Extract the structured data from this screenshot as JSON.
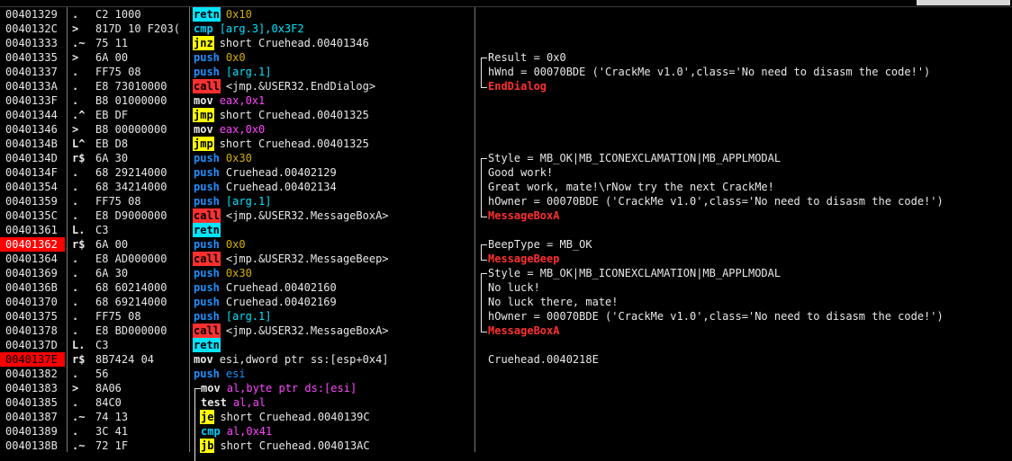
{
  "window": {
    "title": ""
  },
  "colors": {
    "background": "#000000",
    "breakpoint": "#ff0000",
    "ret": "#00e5ff",
    "jmp": "#ffff00",
    "call": "#ff3030",
    "push": "#1e90ff"
  },
  "rows": [
    {
      "addr": "00401329",
      "gutter": ".",
      "hex": "C2 1000",
      "mnem": "retn",
      "mclass": "m-ret",
      "ops": "0x10",
      "oclass": "op-gold",
      "comment": ""
    },
    {
      "addr": "0040132C",
      "gutter": ">",
      "hex": "817D 10 F203(",
      "mnem": "cmp",
      "mclass": "m-cmp",
      "ops": "[arg.3],0x3F2",
      "oclass": "op-cyan",
      "comment": ""
    },
    {
      "addr": "00401333",
      "gutter": ".~",
      "hex": "75 11",
      "mnem": "jnz",
      "mclass": "m-jmp",
      "ops": "short Cruehead.00401346",
      "oclass": "op-white",
      "comment": ""
    },
    {
      "addr": "00401335",
      "gutter": ">",
      "hex": "6A 00",
      "mnem": "push",
      "mclass": "m-push",
      "ops": "0x0",
      "oclass": "op-gold",
      "comment": "Result = 0x0"
    },
    {
      "addr": "00401337",
      "gutter": ".",
      "hex": "FF75 08",
      "mnem": "push",
      "mclass": "m-push",
      "ops": "[arg.1]",
      "oclass": "op-cyan",
      "comment": "hWnd = 00070BDE ('CrackMe v1.0',class='No need to disasm the code!')"
    },
    {
      "addr": "0040133A",
      "gutter": ".",
      "hex": "E8 73010000",
      "mnem": "call",
      "mclass": "m-call",
      "ops": "<jmp.&USER32.EndDialog>",
      "oclass": "op-white",
      "comment": "EndDialog",
      "red": true
    },
    {
      "addr": "0040133F",
      "gutter": ".",
      "hex": "B8 01000000",
      "mnem": "mov",
      "mclass": "m-mov",
      "ops": "eax,0x1",
      "oclass": "op-mag",
      "comment": ""
    },
    {
      "addr": "00401344",
      "gutter": ".^",
      "hex": "EB DF",
      "mnem": "jmp",
      "mclass": "m-jmp",
      "ops": "short Cruehead.00401325",
      "oclass": "op-white",
      "comment": ""
    },
    {
      "addr": "00401346",
      "gutter": ">",
      "hex": "B8 00000000",
      "mnem": "mov",
      "mclass": "m-mov",
      "ops": "eax,0x0",
      "oclass": "op-mag",
      "comment": ""
    },
    {
      "addr": "0040134B",
      "gutter": "L^",
      "hex": "EB D8",
      "mnem": "jmp",
      "mclass": "m-jmp",
      "ops": "short Cruehead.00401325",
      "oclass": "op-white",
      "comment": ""
    },
    {
      "addr": "0040134D",
      "gutter": "r$",
      "hex": "6A 30",
      "mnem": "push",
      "mclass": "m-push",
      "ops": "0x30",
      "oclass": "op-gold",
      "comment": "Style = MB_OK|MB_ICONEXCLAMATION|MB_APPLMODAL"
    },
    {
      "addr": "0040134F",
      "gutter": ".",
      "hex": "68 29214000",
      "mnem": "push",
      "mclass": "m-push",
      "ops": "Cruehead.00402129",
      "oclass": "op-white",
      "comment": "Good work!"
    },
    {
      "addr": "00401354",
      "gutter": ".",
      "hex": "68 34214000",
      "mnem": "push",
      "mclass": "m-push",
      "ops": "Cruehead.00402134",
      "oclass": "op-white",
      "comment": "Great work, mate!\\rNow try the next CrackMe!"
    },
    {
      "addr": "00401359",
      "gutter": ".",
      "hex": "FF75 08",
      "mnem": "push",
      "mclass": "m-push",
      "ops": "[arg.1]",
      "oclass": "op-cyan",
      "comment": "hOwner = 00070BDE ('CrackMe v1.0',class='No need to disasm the code!')"
    },
    {
      "addr": "0040135C",
      "gutter": ".",
      "hex": "E8 D9000000",
      "mnem": "call",
      "mclass": "m-call",
      "ops": "<jmp.&USER32.MessageBoxA>",
      "oclass": "op-white",
      "comment": "MessageBoxA",
      "red": true
    },
    {
      "addr": "00401361",
      "gutter": "L.",
      "hex": "C3",
      "mnem": "retn",
      "mclass": "m-ret",
      "ops": "",
      "oclass": "op-white",
      "comment": ""
    },
    {
      "addr": "00401362",
      "gutter": "r$",
      "hex": "6A 00",
      "mnem": "push",
      "mclass": "m-push",
      "ops": "0x0",
      "oclass": "op-gold",
      "comment": "BeepType = MB_OK",
      "bp": true
    },
    {
      "addr": "00401364",
      "gutter": ".",
      "hex": "E8 AD000000",
      "mnem": "call",
      "mclass": "m-call",
      "ops": "<jmp.&USER32.MessageBeep>",
      "oclass": "op-white",
      "comment": "MessageBeep",
      "red": true
    },
    {
      "addr": "00401369",
      "gutter": ".",
      "hex": "6A 30",
      "mnem": "push",
      "mclass": "m-push",
      "ops": "0x30",
      "oclass": "op-gold",
      "comment": "Style = MB_OK|MB_ICONEXCLAMATION|MB_APPLMODAL"
    },
    {
      "addr": "0040136B",
      "gutter": ".",
      "hex": "68 60214000",
      "mnem": "push",
      "mclass": "m-push",
      "ops": "Cruehead.00402160",
      "oclass": "op-white",
      "comment": "No luck!"
    },
    {
      "addr": "00401370",
      "gutter": ".",
      "hex": "68 69214000",
      "mnem": "push",
      "mclass": "m-push",
      "ops": "Cruehead.00402169",
      "oclass": "op-white",
      "comment": "No luck there, mate!"
    },
    {
      "addr": "00401375",
      "gutter": ".",
      "hex": "FF75 08",
      "mnem": "push",
      "mclass": "m-push",
      "ops": "[arg.1]",
      "oclass": "op-cyan",
      "comment": "hOwner = 00070BDE ('CrackMe v1.0',class='No need to disasm the code!')"
    },
    {
      "addr": "00401378",
      "gutter": ".",
      "hex": "E8 BD000000",
      "mnem": "call",
      "mclass": "m-call",
      "ops": "<jmp.&USER32.MessageBoxA>",
      "oclass": "op-white",
      "comment": "MessageBoxA",
      "red": true
    },
    {
      "addr": "0040137D",
      "gutter": "L.",
      "hex": "C3",
      "mnem": "retn",
      "mclass": "m-ret",
      "ops": "",
      "oclass": "op-white",
      "comment": ""
    },
    {
      "addr": "0040137E",
      "gutter": "r$",
      "hex": "8B7424 04",
      "mnem": "mov",
      "mclass": "m-mov",
      "ops": "esi,dword ptr ss:[esp+0x4]",
      "oclass": "op-white",
      "comment": "Cruehead.0040218E",
      "sel": true
    },
    {
      "addr": "00401382",
      "gutter": ".",
      "hex": "56",
      "mnem": "push",
      "mclass": "m-push",
      "ops": "esi",
      "oclass": "op-blue",
      "comment": ""
    },
    {
      "addr": "00401383",
      "gutter": ">",
      "hex": "8A06",
      "mnem": "mov",
      "mclass": "m-mov",
      "ops": "al,byte ptr ds:[esi]",
      "oclass": "op-mag",
      "comment": "",
      "indent": true
    },
    {
      "addr": "00401385",
      "gutter": ".",
      "hex": "84C0",
      "mnem": "test",
      "mclass": "m-test",
      "ops": "al,al",
      "oclass": "op-mag",
      "comment": "",
      "indent": true
    },
    {
      "addr": "00401387",
      "gutter": ".~",
      "hex": "74 13",
      "mnem": "je",
      "mclass": "m-jmp",
      "ops": "short Cruehead.0040139C",
      "oclass": "op-white",
      "comment": "",
      "indent": true
    },
    {
      "addr": "00401389",
      "gutter": ".",
      "hex": "3C 41",
      "mnem": "cmp",
      "mclass": "m-cmp",
      "ops": "al,0x41",
      "oclass": "op-mag",
      "comment": "",
      "indent": true
    },
    {
      "addr": "0040138B",
      "gutter": ".~",
      "hex": "72 1F",
      "mnem": "jb",
      "mclass": "m-jmp",
      "ops": "short Cruehead.004013AC",
      "oclass": "op-white",
      "comment": "",
      "indent": true
    }
  ]
}
